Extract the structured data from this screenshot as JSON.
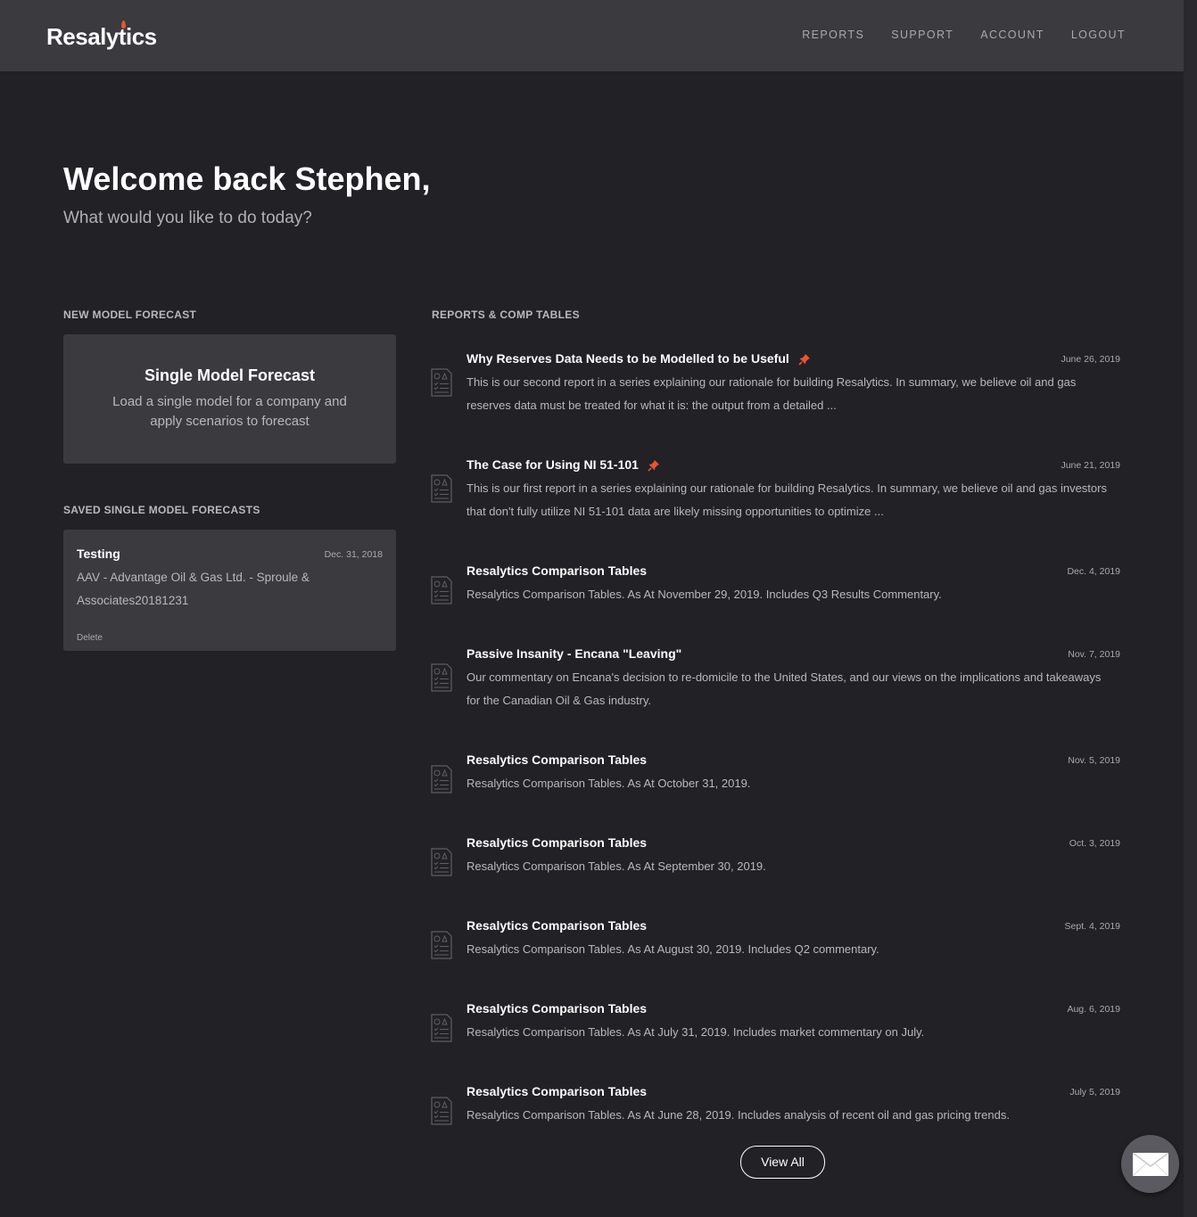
{
  "header": {
    "logo": "Resalytics",
    "nav": [
      "REPORTS",
      "SUPPORT",
      "ACCOUNT",
      "LOGOUT"
    ]
  },
  "hero": {
    "title": "Welcome back Stephen,",
    "subtitle": "What would you like to do today?"
  },
  "new_model": {
    "section_label": "NEW MODEL FORECAST",
    "card_title": "Single Model Forecast",
    "card_desc": "Load a single model for a company and apply scenarios to forecast"
  },
  "saved": {
    "section_label": "SAVED SINGLE MODEL FORECASTS",
    "items": [
      {
        "name": "Testing",
        "date": "Dec. 31, 2018",
        "detail": "AAV - Advantage Oil & Gas Ltd. - Sproule & Associates20181231",
        "delete_label": "Delete"
      }
    ]
  },
  "reports": {
    "section_label": "REPORTS & COMP TABLES",
    "items": [
      {
        "title": "Why Reserves Data Needs to be Modelled to be Useful",
        "pinned": true,
        "date": "June 26, 2019",
        "summary": "This is our second report in a series explaining our rationale for building Resalytics. In summary, we believe oil and gas reserves data must be treated for what it is: the output from a detailed ..."
      },
      {
        "title": "The Case for Using NI 51-101",
        "pinned": true,
        "date": "June 21, 2019",
        "summary": "This is our first report in a series explaining our rationale for building Resalytics. In summary, we believe oil and gas investors that don't fully utilize NI 51-101 data are likely missing opportunities to optimize ..."
      },
      {
        "title": "Resalytics Comparison Tables",
        "pinned": false,
        "date": "Dec. 4, 2019",
        "summary": "Resalytics Comparison Tables. As At November 29, 2019. Includes Q3 Results Commentary."
      },
      {
        "title": "Passive Insanity - Encana \"Leaving\"",
        "pinned": false,
        "date": "Nov. 7, 2019",
        "summary": "Our commentary on Encana's decision to re-domicile to the United States, and our views on the implications and takeaways for the Canadian Oil & Gas industry."
      },
      {
        "title": "Resalytics Comparison Tables",
        "pinned": false,
        "date": "Nov. 5, 2019",
        "summary": "Resalytics Comparison Tables. As At October 31, 2019."
      },
      {
        "title": "Resalytics Comparison Tables",
        "pinned": false,
        "date": "Oct. 3, 2019",
        "summary": "Resalytics Comparison Tables. As At September 30, 2019."
      },
      {
        "title": "Resalytics Comparison Tables",
        "pinned": false,
        "date": "Sept. 4, 2019",
        "summary": "Resalytics Comparison Tables. As At August 30, 2019. Includes Q2 commentary."
      },
      {
        "title": "Resalytics Comparison Tables",
        "pinned": false,
        "date": "Aug. 6, 2019",
        "summary": "Resalytics Comparison Tables. As At July 31, 2019. Includes market commentary on July."
      },
      {
        "title": "Resalytics Comparison Tables",
        "pinned": false,
        "date": "July 5, 2019",
        "summary": "Resalytics Comparison Tables. As At June 28, 2019. Includes analysis of recent oil and gas pricing trends."
      }
    ],
    "view_all_label": "View All"
  },
  "colors": {
    "background": "#222126",
    "header": "#3a3a3f",
    "card": "#3a3a3f",
    "pin_accent": "#e8552e",
    "text_muted": "#b8b8be"
  },
  "icons": {
    "report": "report-document-icon",
    "pin": "pushpin-icon",
    "mail": "envelope-icon"
  }
}
